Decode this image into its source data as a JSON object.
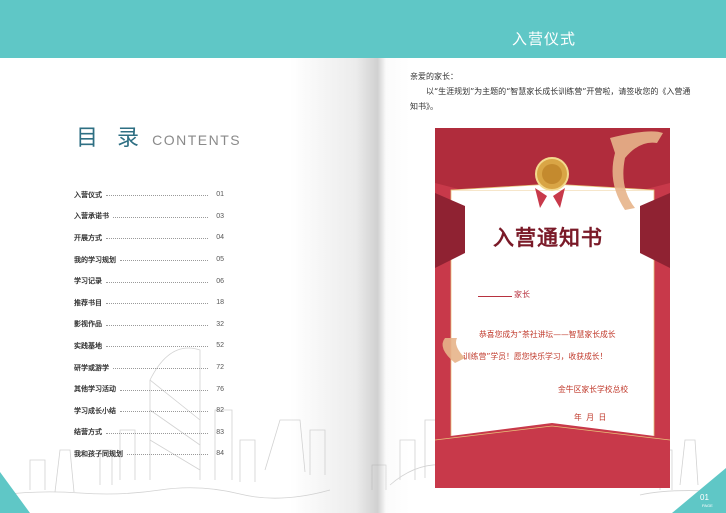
{
  "header": {
    "title": "入营仪式"
  },
  "toc": {
    "title": "目 录",
    "title_en": "CONTENTS",
    "items": [
      {
        "label": "入营仪式",
        "page": "01"
      },
      {
        "label": "入营承诺书",
        "page": "03"
      },
      {
        "label": "开展方式",
        "page": "04"
      },
      {
        "label": "我的学习规划",
        "page": "05"
      },
      {
        "label": "学习记录",
        "page": "06"
      },
      {
        "label": "推荐书目",
        "page": "18"
      },
      {
        "label": "影视作品",
        "page": "32"
      },
      {
        "label": "实践基地",
        "page": "52"
      },
      {
        "label": "研学或游学",
        "page": "72"
      },
      {
        "label": "其他学习活动",
        "page": "76"
      },
      {
        "label": "学习成长小结",
        "page": "82"
      },
      {
        "label": "结营方式",
        "page": "83"
      },
      {
        "label": "我和孩子同规划",
        "page": "84"
      }
    ]
  },
  "letter": {
    "greeting": "亲爱的家长：",
    "body": "以“生涯规划”为主题的“智慧家长成长训练营”开营啦，请签收您的《入营通知书》。"
  },
  "notice": {
    "title": "入营通知书",
    "parent_suffix": "家长",
    "body_line1": "恭喜您成为“茶社讲坛——智慧家长成长",
    "body_line2": "训练营”学员！愿您快乐学习，收获成长！",
    "signature": "金牛区家长学校总校",
    "date": "年   月   日"
  },
  "footer": {
    "page_number": "01",
    "page_label": "PAGE"
  },
  "colors": {
    "teal": "#5fc7c6",
    "red": "#c8394a",
    "dark_red": "#7a1a28",
    "gold": "#d9a545"
  }
}
